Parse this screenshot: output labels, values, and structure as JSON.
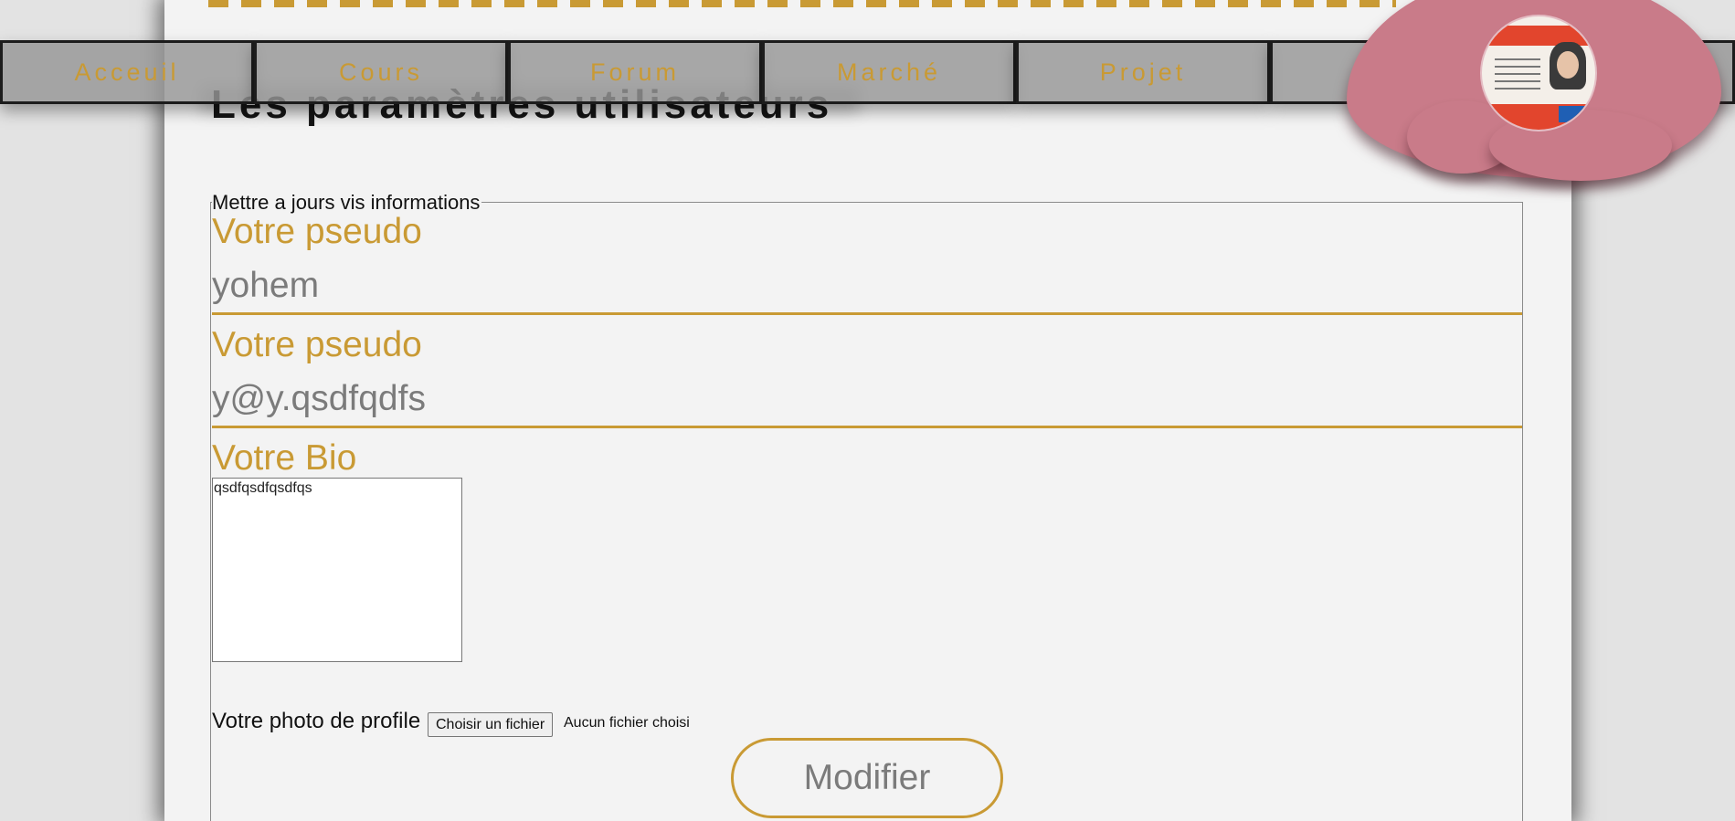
{
  "page": {
    "title": "Les paramètres utilisateurs"
  },
  "nav": {
    "items": [
      {
        "label": "Acceuil"
      },
      {
        "label": "Cours"
      },
      {
        "label": "Forum"
      },
      {
        "label": "Marché"
      },
      {
        "label": "Projet"
      },
      {
        "label": ""
      }
    ]
  },
  "profile": {
    "avatar_icon": "profile-photo"
  },
  "form": {
    "legend": "Mettre a jours vis informations",
    "pseudo_label": "Votre pseudo",
    "pseudo_value": "yohem",
    "email_label": "Votre pseudo",
    "email_value": "y@y.qsdfqdfs",
    "bio_label": "Votre Bio",
    "bio_value": "qsdfqsdfqsdfqs",
    "photo_label": "Votre photo de profile",
    "file_button_label": "Choisir un fichier",
    "file_status": "Aucun fichier choisi",
    "submit_label": "Modifier"
  },
  "colors": {
    "accent": "#c99a34",
    "blob": "#c97b89",
    "nav_bg": "#969696",
    "sheet_bg": "#f3f3f3"
  }
}
